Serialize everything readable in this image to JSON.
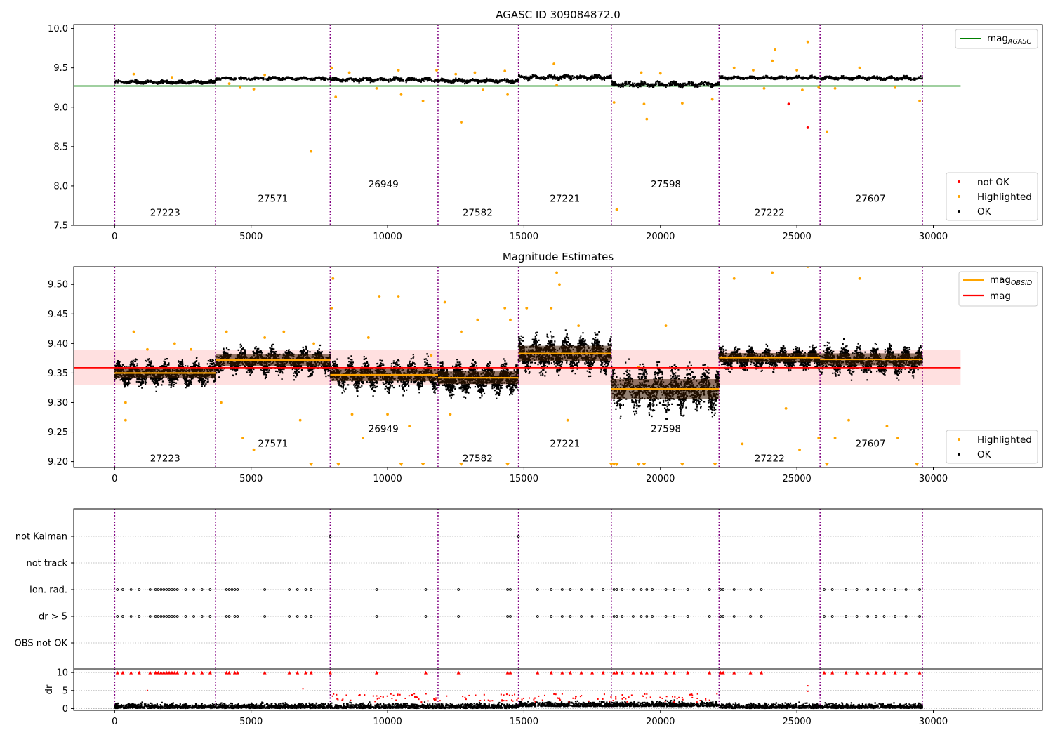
{
  "chart_data": [
    {
      "type": "scatter",
      "title": "AGASC ID 309084872.0",
      "xlim": [
        -1500,
        34000
      ],
      "ylim": [
        7.5,
        10.05
      ],
      "xticks": [
        0,
        5000,
        10000,
        15000,
        20000,
        25000,
        30000
      ],
      "yticks": [
        7.5,
        8.0,
        8.5,
        9.0,
        9.5,
        10.0
      ],
      "ytick_labels": [
        "7.5",
        "8.0",
        "8.5",
        "9.0",
        "9.5",
        "10.0"
      ],
      "obs_boundaries": [
        0,
        3700,
        7900,
        11850,
        14800,
        18200,
        22150,
        25850,
        29600
      ],
      "obsids": [
        {
          "label": "27223",
          "x": 1850,
          "y": 7.62
        },
        {
          "label": "27571",
          "x": 5800,
          "y": 7.8
        },
        {
          "label": "26949",
          "x": 9850,
          "y": 7.98
        },
        {
          "label": "27582",
          "x": 13300,
          "y": 7.62
        },
        {
          "label": "27221",
          "x": 16500,
          "y": 7.8
        },
        {
          "label": "27598",
          "x": 20200,
          "y": 7.98
        },
        {
          "label": "27222",
          "x": 24000,
          "y": 7.62
        },
        {
          "label": "27607",
          "x": 27700,
          "y": 7.8
        }
      ],
      "segment_levels": [
        9.33,
        9.375,
        9.36,
        9.345,
        9.39,
        9.3,
        9.385,
        9.38
      ],
      "agasc_mag": 9.27,
      "agasc_xrange": [
        -1500,
        31000
      ],
      "highlighted_points": [
        [
          700,
          9.42
        ],
        [
          2100,
          9.38
        ],
        [
          4200,
          9.3
        ],
        [
          4600,
          9.25
        ],
        [
          5100,
          9.23
        ],
        [
          5500,
          9.41
        ],
        [
          7200,
          8.44
        ],
        [
          8100,
          9.13
        ],
        [
          7950,
          9.5
        ],
        [
          8600,
          9.44
        ],
        [
          9600,
          9.24
        ],
        [
          10400,
          9.47
        ],
        [
          10500,
          9.16
        ],
        [
          11300,
          9.08
        ],
        [
          11800,
          9.47
        ],
        [
          12500,
          9.42
        ],
        [
          12700,
          8.81
        ],
        [
          13200,
          9.44
        ],
        [
          13500,
          9.22
        ],
        [
          14300,
          9.46
        ],
        [
          14400,
          9.16
        ],
        [
          16200,
          9.28
        ],
        [
          16100,
          9.55
        ],
        [
          18300,
          9.06
        ],
        [
          18400,
          7.7
        ],
        [
          19300,
          9.44
        ],
        [
          19500,
          8.85
        ],
        [
          19400,
          9.04
        ],
        [
          20000,
          9.43
        ],
        [
          20800,
          9.05
        ],
        [
          21900,
          9.1
        ],
        [
          22700,
          9.5
        ],
        [
          23400,
          9.47
        ],
        [
          23800,
          9.24
        ],
        [
          24100,
          9.59
        ],
        [
          24200,
          9.73
        ],
        [
          25000,
          9.47
        ],
        [
          25400,
          9.83
        ],
        [
          25800,
          9.25
        ],
        [
          26100,
          8.69
        ],
        [
          26400,
          9.24
        ],
        [
          27300,
          9.5
        ],
        [
          28600,
          9.25
        ],
        [
          29500,
          9.08
        ],
        [
          25200,
          9.22
        ]
      ],
      "notok_points": [
        [
          24700,
          9.04
        ],
        [
          25400,
          8.74
        ]
      ],
      "legend_upper": [
        "mag_AGASC"
      ],
      "legend_lower": [
        "not OK",
        "Highlighted",
        "OK"
      ],
      "series_colors": {
        "ok": "#000000",
        "highlighted": "#ffa500",
        "notok": "#ff0000",
        "agasc": "#008000",
        "boundary": "#800080"
      }
    },
    {
      "type": "scatter",
      "title": "Magnitude Estimates",
      "xlim": [
        -1500,
        34000
      ],
      "ylim": [
        9.19,
        9.53
      ],
      "xticks": [
        0,
        5000,
        10000,
        15000,
        20000,
        25000,
        30000
      ],
      "yticks": [
        9.2,
        9.25,
        9.3,
        9.35,
        9.4,
        9.45,
        9.5
      ],
      "ytick_labels": [
        "9.20",
        "9.25",
        "9.30",
        "9.35",
        "9.40",
        "9.45",
        "9.50"
      ],
      "obsids": [
        {
          "label": "27223",
          "x": 1850,
          "y": 9.2
        },
        {
          "label": "27571",
          "x": 5800,
          "y": 9.225
        },
        {
          "label": "26949",
          "x": 9850,
          "y": 9.25
        },
        {
          "label": "27582",
          "x": 13300,
          "y": 9.2
        },
        {
          "label": "27221",
          "x": 16500,
          "y": 9.225
        },
        {
          "label": "27598",
          "x": 20200,
          "y": 9.25
        },
        {
          "label": "27222",
          "x": 24000,
          "y": 9.2
        },
        {
          "label": "27607",
          "x": 27700,
          "y": 9.225
        }
      ],
      "mag_obsid": [
        9.35,
        9.372,
        9.347,
        9.342,
        9.383,
        9.323,
        9.376,
        9.373
      ],
      "segment_spread": [
        0.015,
        0.016,
        0.018,
        0.018,
        0.022,
        0.028,
        0.013,
        0.017
      ],
      "mag": 9.359,
      "mag_band": [
        9.33,
        9.389
      ],
      "highlighted_points": [
        [
          400,
          9.3
        ],
        [
          400,
          9.27
        ],
        [
          700,
          9.42
        ],
        [
          1200,
          9.39
        ],
        [
          2200,
          9.4
        ],
        [
          2800,
          9.39
        ],
        [
          3900,
          9.3
        ],
        [
          4100,
          9.42
        ],
        [
          4700,
          9.24
        ],
        [
          5100,
          9.22
        ],
        [
          5500,
          9.41
        ],
        [
          6200,
          9.42
        ],
        [
          6800,
          9.27
        ],
        [
          7300,
          9.4
        ],
        [
          7950,
          9.46
        ],
        [
          8000,
          9.51
        ],
        [
          8700,
          9.28
        ],
        [
          9100,
          9.24
        ],
        [
          9300,
          9.41
        ],
        [
          9700,
          9.48
        ],
        [
          10000,
          9.28
        ],
        [
          10400,
          9.48
        ],
        [
          10800,
          9.26
        ],
        [
          11600,
          9.38
        ],
        [
          12100,
          9.47
        ],
        [
          12300,
          9.28
        ],
        [
          12700,
          9.42
        ],
        [
          13300,
          9.44
        ],
        [
          14300,
          9.46
        ],
        [
          14500,
          9.44
        ],
        [
          15100,
          9.46
        ],
        [
          16000,
          9.46
        ],
        [
          16200,
          9.52
        ],
        [
          16300,
          9.5
        ],
        [
          16600,
          9.27
        ],
        [
          17000,
          9.43
        ],
        [
          19200,
          9.36
        ],
        [
          20200,
          9.43
        ],
        [
          22700,
          9.51
        ],
        [
          23000,
          9.23
        ],
        [
          24100,
          9.52
        ],
        [
          24600,
          9.29
        ],
        [
          25100,
          9.22
        ],
        [
          25400,
          9.53
        ],
        [
          25800,
          9.24
        ],
        [
          26400,
          9.24
        ],
        [
          27300,
          9.51
        ],
        [
          26900,
          9.27
        ],
        [
          28300,
          9.26
        ],
        [
          28700,
          9.24
        ]
      ],
      "below_range_markers": [
        7200,
        8200,
        10500,
        11300,
        12700,
        14400,
        18200,
        18300,
        18400,
        19200,
        19400,
        20800,
        22000,
        26100,
        29400
      ],
      "legend_upper": [
        "mag_OBSID",
        "mag"
      ],
      "legend_lower": [
        "Highlighted",
        "OK"
      ],
      "series_colors": {
        "ok": "#000000",
        "highlighted": "#ffa500",
        "mag_obsid": "#ffa500",
        "mag": "#ff0000",
        "band": "#ffd6d6"
      }
    },
    {
      "type": "scatter",
      "title": "",
      "xlim": [
        -1500,
        34000
      ],
      "flag_categories": [
        "not Kalman",
        "not track",
        "Ion. rad.",
        "dr > 5",
        "OBS not OK"
      ],
      "flag_points": {
        "Ion. rad.": [
          100,
          300,
          600,
          900,
          1300,
          1500,
          1600,
          1700,
          1800,
          1900,
          2000,
          2100,
          2200,
          2300,
          2600,
          2900,
          3200,
          3500,
          4100,
          4200,
          4300,
          4400,
          4500,
          5500,
          6400,
          6700,
          7000,
          7200,
          9600,
          11400,
          12600,
          14400,
          14500,
          15500,
          16000,
          16400,
          16700,
          17100,
          17500,
          17900,
          18300,
          18400,
          18600,
          19000,
          19300,
          19500,
          19700,
          20200,
          20500,
          21000,
          21800,
          22200,
          22300,
          22700,
          23300,
          23700,
          26000,
          26300,
          26800,
          27200,
          27600,
          27900,
          28200,
          28600,
          29000,
          29500
        ],
        "dr > 5": [
          100,
          300,
          600,
          900,
          1300,
          1500,
          1600,
          1700,
          1800,
          1900,
          2000,
          2100,
          2200,
          2300,
          2600,
          2900,
          3200,
          3500,
          4100,
          4200,
          4400,
          4500,
          5500,
          6400,
          6700,
          7000,
          7200,
          9600,
          11400,
          12600,
          14400,
          14500,
          15500,
          16000,
          16400,
          16700,
          17100,
          17500,
          17900,
          18300,
          18400,
          18600,
          19000,
          19300,
          19500,
          19700,
          20200,
          20500,
          21000,
          21800,
          22200,
          22300,
          22700,
          23300,
          23700,
          26000,
          26300,
          26800,
          27200,
          27600,
          27900,
          28200,
          28600,
          29000,
          29500
        ],
        "not Kalman": [
          7900,
          14800
        ]
      },
      "dr_ylabel": "dr",
      "dr_yticks": [
        0,
        5,
        10
      ],
      "dr_ylim": [
        -0.5,
        11
      ],
      "dr_clipped_x": [
        100,
        300,
        600,
        900,
        1300,
        1500,
        1600,
        1700,
        1800,
        1900,
        2000,
        2100,
        2200,
        2300,
        2600,
        2900,
        3200,
        3500,
        4100,
        4200,
        4400,
        4500,
        5500,
        6400,
        6700,
        7000,
        7200,
        7900,
        9600,
        11400,
        12600,
        14400,
        14500,
        15500,
        16000,
        16400,
        16700,
        17100,
        17500,
        17900,
        18300,
        18400,
        18600,
        19000,
        19300,
        19500,
        19700,
        20200,
        20500,
        21000,
        21800,
        22200,
        22300,
        22700,
        23300,
        23700,
        26000,
        26300,
        26800,
        27200,
        27600,
        27900,
        28200,
        28600,
        29000,
        29500
      ],
      "dr_outliers": [
        [
          1200,
          5.0
        ],
        [
          6900,
          5.5
        ],
        [
          9600,
          3.5
        ],
        [
          16100,
          4.0
        ],
        [
          19500,
          4.0
        ],
        [
          25400,
          6.3
        ],
        [
          25400,
          4.8
        ],
        [
          20800,
          3.0
        ]
      ],
      "xticks": [
        0,
        5000,
        10000,
        15000,
        20000,
        25000,
        30000
      ]
    }
  ]
}
